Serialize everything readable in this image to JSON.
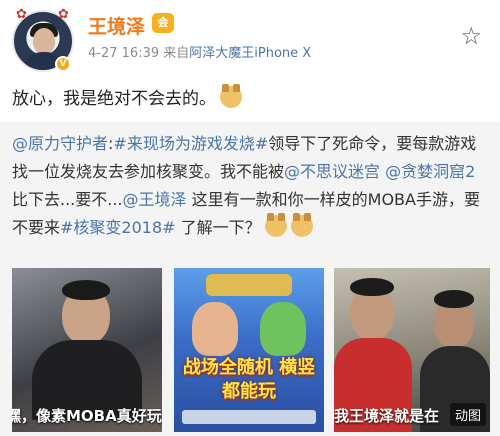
{
  "author": {
    "name": "王境泽",
    "vip_badge": "会",
    "verified_badge": "V",
    "date": "4-27",
    "time": "16:39",
    "source_prefix": "来自",
    "source_name": "阿泽大魔王iPhone X"
  },
  "post": {
    "text": "放心，我是绝对不会去的。"
  },
  "repost": {
    "segments": [
      {
        "text": "@原力守护者",
        "link": true
      },
      {
        "text": ":",
        "link": false
      },
      {
        "text": "#来现场为游戏发烧#",
        "link": true
      },
      {
        "text": "领导下了死命令，要每款游戏找一位发烧友去参加核聚变。我不能被",
        "link": false
      },
      {
        "text": "@不思议迷宫",
        "link": true
      },
      {
        "text": " ",
        "link": false
      },
      {
        "text": "@贪婪洞窟2",
        "link": true
      },
      {
        "text": " 比下去...要不...",
        "link": false
      },
      {
        "text": "@王境泽",
        "link": true
      },
      {
        "text": " 这里有一款和你一样皮的MOBA手游，要不要来",
        "link": false
      },
      {
        "text": "#核聚变2018#",
        "link": true
      },
      {
        "text": " 了解一下？",
        "link": false
      }
    ]
  },
  "media": [
    {
      "caption": "嘿，像素MOBA真好玩"
    },
    {
      "caption": "战场全随机 横竖都能玩"
    },
    {
      "caption": "我王境泽就是在"
    }
  ],
  "media_tag": "动图",
  "icons": {
    "star": "star-outline-icon"
  },
  "colors": {
    "name": "#f07a1b",
    "link": "#4a75a8",
    "meta": "#8a8a8a"
  }
}
